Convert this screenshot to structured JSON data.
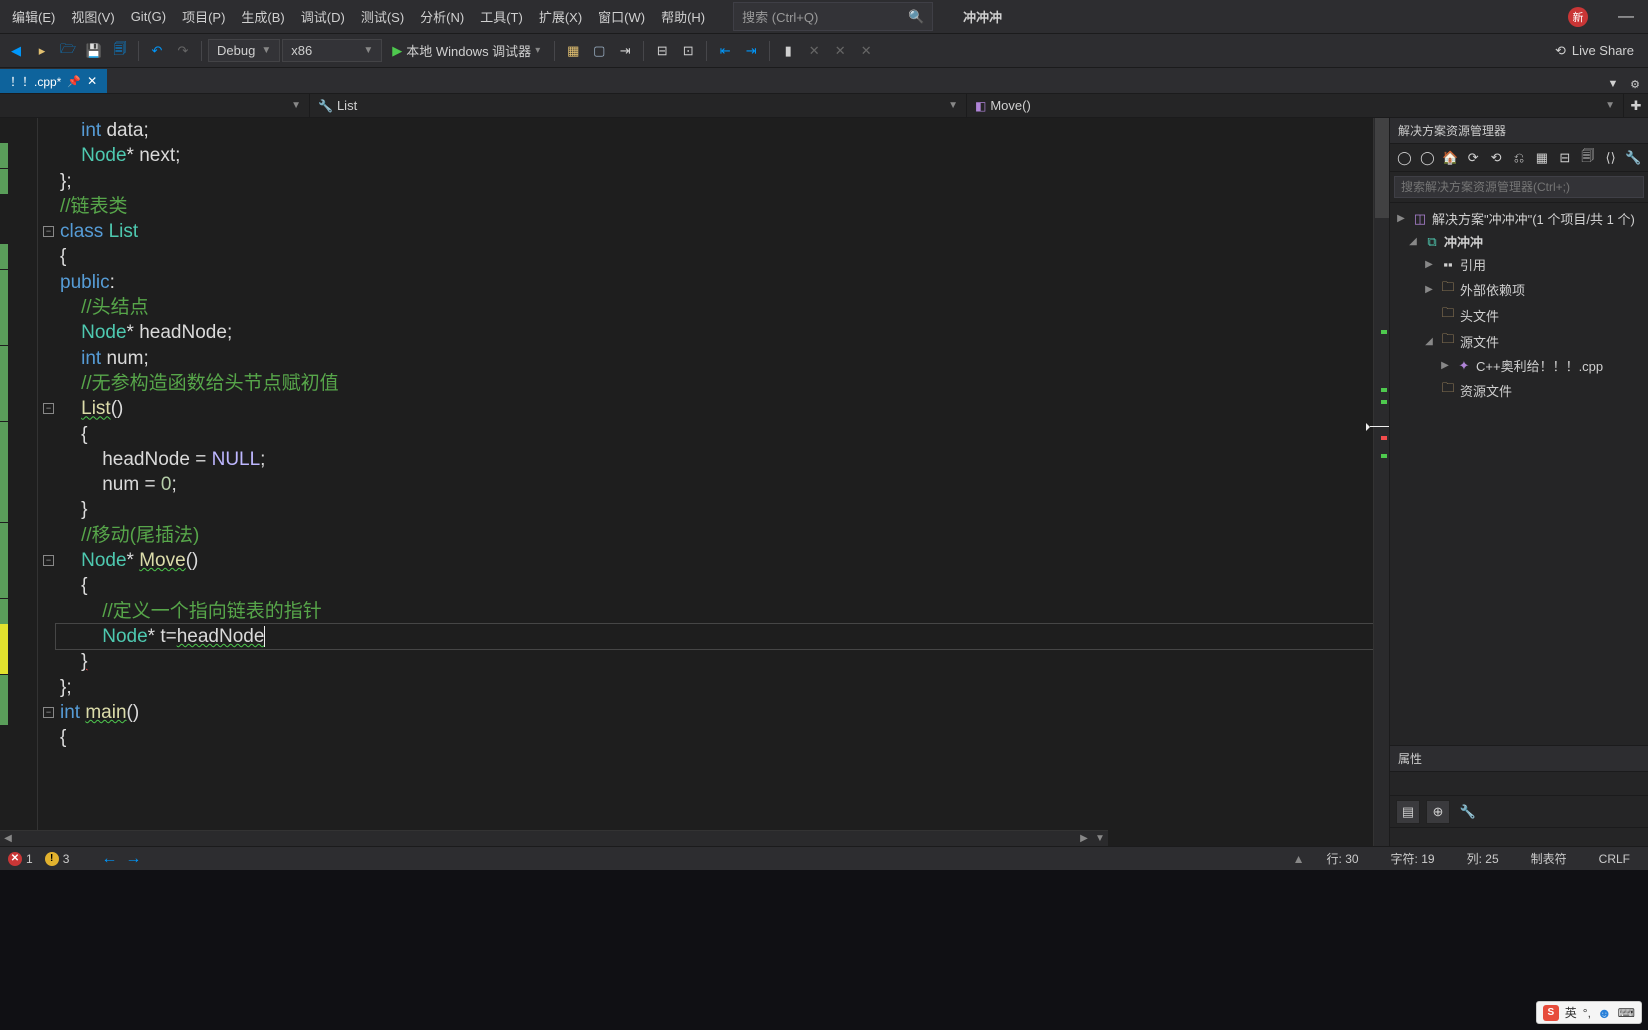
{
  "menu": {
    "items": [
      "编辑(E)",
      "视图(V)",
      "Git(G)",
      "项目(P)",
      "生成(B)",
      "调试(D)",
      "测试(S)",
      "分析(N)",
      "工具(T)",
      "扩展(X)",
      "窗口(W)",
      "帮助(H)"
    ],
    "search_placeholder": "搜索 (Ctrl+Q)",
    "title": "冲冲冲",
    "badge": "新"
  },
  "toolbar": {
    "config": "Debug",
    "platform": "x86",
    "run_label": "本地 Windows 调试器",
    "liveshare": "Live Share"
  },
  "tab": {
    "name": "！！.cpp*"
  },
  "nav": {
    "scope": "",
    "class": "List",
    "member": "Move()"
  },
  "code_lines": [
    {
      "t": "    <kw>int</kw> <field>data</field>;",
      "mark": "green"
    },
    {
      "t": "    <type>Node</type>* <field>next</field>;",
      "mark": "green"
    },
    {
      "t": "};",
      "mark": ""
    },
    {
      "t": "<cmt>//链表类</cmt>",
      "mark": ""
    },
    {
      "t": "<kw>class</kw> <type>List</type>",
      "mark": "green",
      "fold": true
    },
    {
      "t": "{",
      "mark": "green"
    },
    {
      "t": "<kw>public</kw>:",
      "mark": "green"
    },
    {
      "t": "    <cmt>//头结点</cmt>",
      "mark": "green"
    },
    {
      "t": "    <type>Node</type>* <field>headNode</field>;",
      "mark": "green"
    },
    {
      "t": "    <kw>int</kw> <field>num</field>;",
      "mark": "green"
    },
    {
      "t": "    <cmt>//无参构造函数给头节点赋初值</cmt>",
      "mark": "green"
    },
    {
      "t": "    <func sq>List</func>()",
      "mark": "green",
      "fold": true
    },
    {
      "t": "    {",
      "mark": "green"
    },
    {
      "t": "        <field>headNode</field> = <macro>NULL</macro>;",
      "mark": "green"
    },
    {
      "t": "        <field>num</field> = <num>0</num>;",
      "mark": "green"
    },
    {
      "t": "    }",
      "mark": "green"
    },
    {
      "t": "    <cmt>//移动(尾插法)</cmt>",
      "mark": "green"
    },
    {
      "t": "    <type>Node</type>* <func sq>Move</func>()",
      "mark": "green",
      "fold": true
    },
    {
      "t": "    {",
      "mark": "green"
    },
    {
      "t": "        <cmt>//定义一个指向链表的指针</cmt>",
      "mark": "yellow"
    },
    {
      "t": "        <type>Node</type>* t=<field sq>headNode</field>",
      "mark": "yellow",
      "current": true,
      "cursor": true
    },
    {
      "t": "    <sq-red>}</sq-red>",
      "mark": "green"
    },
    {
      "t": "};",
      "mark": "green"
    },
    {
      "t": "<kw>int</kw> <func sq>main</func>()",
      "mark": "",
      "fold": true
    },
    {
      "t": "{",
      "mark": ""
    },
    {
      "t": "",
      "mark": ""
    }
  ],
  "solution": {
    "panel_title": "解决方案资源管理器",
    "search_placeholder": "搜索解决方案资源管理器(Ctrl+;)",
    "root": "解决方案\"冲冲冲\"(1 个项目/共 1 个)",
    "project": "冲冲冲",
    "items": [
      "引用",
      "外部依赖项",
      "头文件",
      "源文件",
      "资源文件"
    ],
    "source_file": "C++奥利给！！！.cpp"
  },
  "properties": {
    "title": "属性"
  },
  "status": {
    "errors": "1",
    "warnings": "3",
    "line_label": "行:",
    "line": "30",
    "char_label": "字符:",
    "char": "19",
    "col_label": "列:",
    "col": "25",
    "insert_mode": "制表符",
    "ending": "CRLF"
  },
  "ime": {
    "lang": "英"
  }
}
